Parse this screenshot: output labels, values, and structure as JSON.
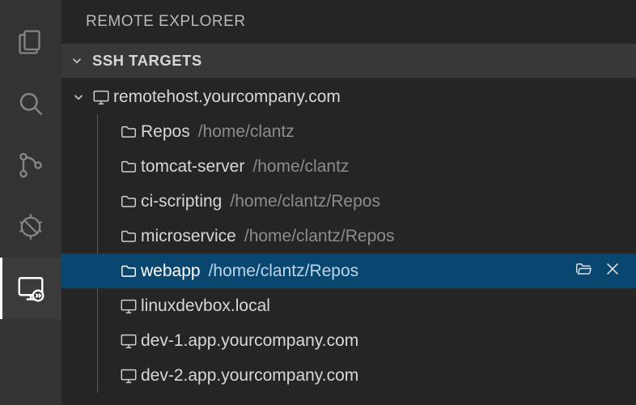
{
  "panel": {
    "title": "REMOTE EXPLORER",
    "section_label": "SSH TARGETS"
  },
  "activitybar": {
    "items": [
      {
        "name": "explorer-icon"
      },
      {
        "name": "search-icon"
      },
      {
        "name": "source-control-icon"
      },
      {
        "name": "debug-icon"
      },
      {
        "name": "remote-explorer-icon",
        "active": true
      }
    ]
  },
  "host": {
    "name": "remotehost.yourcompany.com"
  },
  "folders": [
    {
      "name": "Repos",
      "path": "/home/clantz"
    },
    {
      "name": "tomcat-server",
      "path": "/home/clantz"
    },
    {
      "name": "ci-scripting",
      "path": "/home/clantz/Repos"
    },
    {
      "name": "microservice",
      "path": "/home/clantz/Repos"
    },
    {
      "name": "webapp",
      "path": "/home/clantz/Repos",
      "selected": true
    }
  ],
  "other_hosts": [
    "linuxdevbox.local",
    "dev-1.app.yourcompany.com",
    "dev-2.app.yourcompany.com"
  ],
  "actions": {
    "open_folder": "Open Folder",
    "remove": "Remove"
  }
}
